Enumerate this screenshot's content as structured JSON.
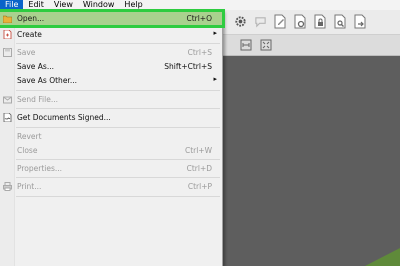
{
  "menubar": {
    "items": [
      {
        "label": "File",
        "active": true
      },
      {
        "label": "Edit",
        "active": false
      },
      {
        "label": "View",
        "active": false
      },
      {
        "label": "Window",
        "active": false
      },
      {
        "label": "Help",
        "active": false
      }
    ]
  },
  "file_menu": {
    "open": {
      "label": "Open...",
      "shortcut": "Ctrl+O"
    },
    "create": {
      "label": "Create"
    },
    "save": {
      "label": "Save",
      "shortcut": "Ctrl+S"
    },
    "save_as": {
      "label": "Save As...",
      "shortcut": "Shift+Ctrl+S"
    },
    "save_as_other": {
      "label": "Save As Other..."
    },
    "send_file": {
      "label": "Send File..."
    },
    "get_signed": {
      "label": "Get Documents Signed..."
    },
    "revert": {
      "label": "Revert"
    },
    "close": {
      "label": "Close",
      "shortcut": "Ctrl+W"
    },
    "properties": {
      "label": "Properties...",
      "shortcut": "Ctrl+D"
    },
    "print": {
      "label": "Print...",
      "shortcut": "Ctrl+P"
    }
  },
  "colors": {
    "highlight_border": "#2ecc40",
    "highlight_fill": "#a9d18e",
    "menubar_active": "#0a63c9"
  }
}
